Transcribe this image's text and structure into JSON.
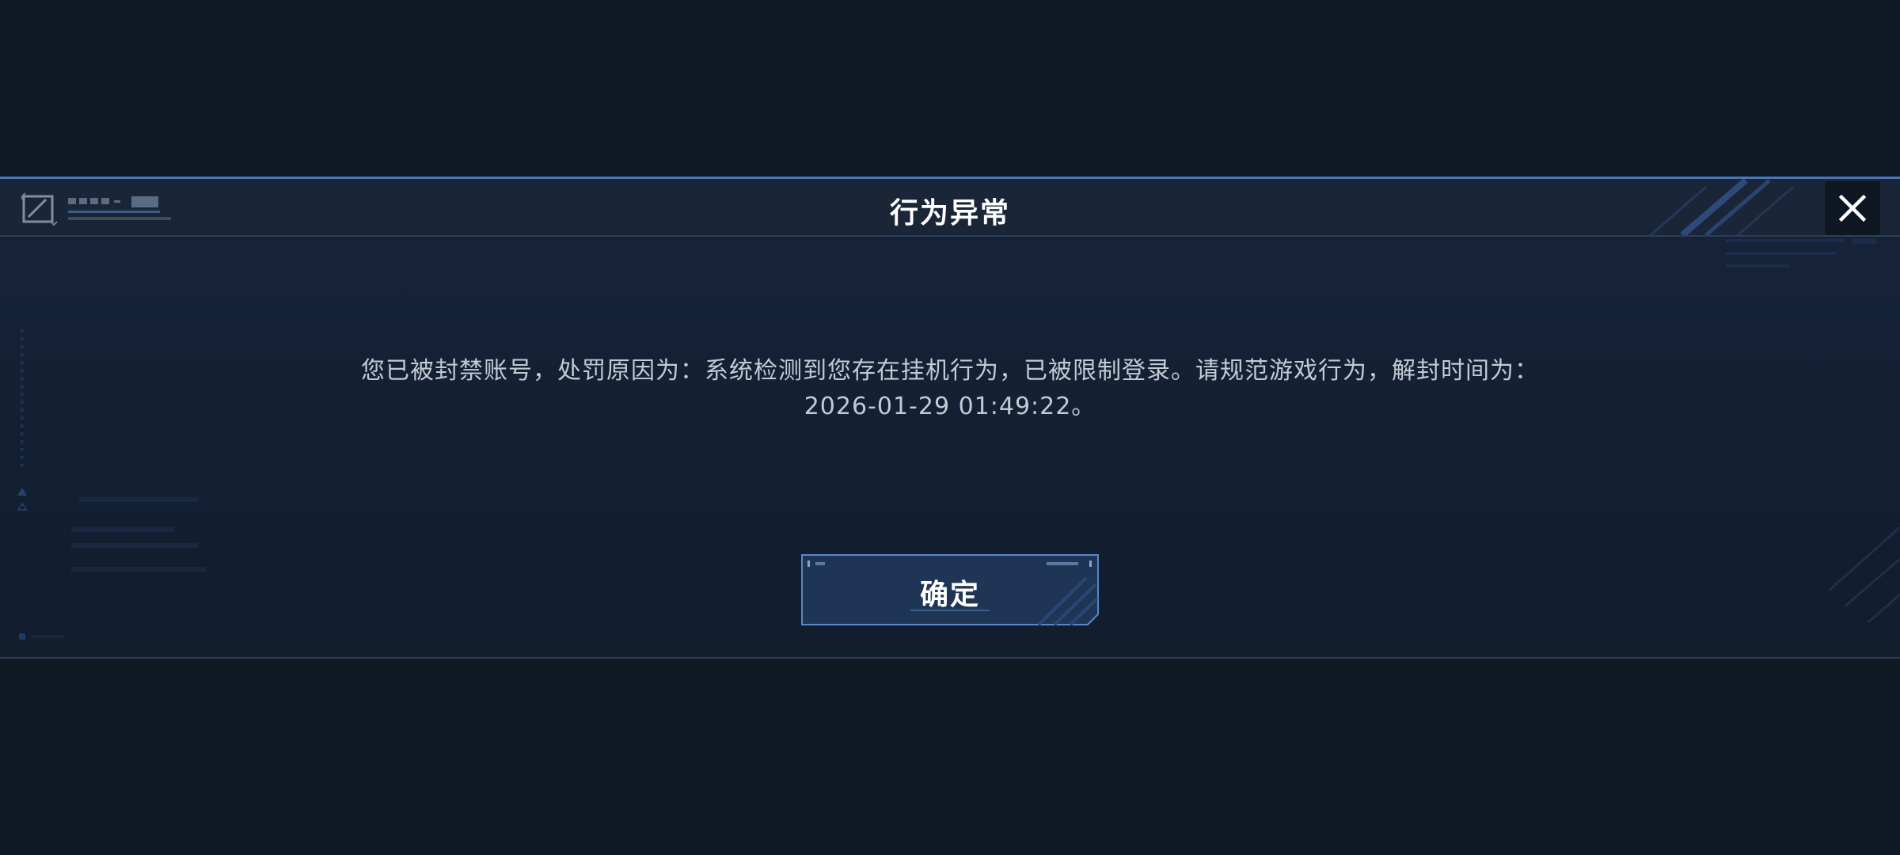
{
  "dialog": {
    "title": "行为异常",
    "message": "您已被封禁账号，处罚原因为：系统检测到您存在挂机行为，已被限制登录。请规范游戏行为，解封时间为：2026-01-29 01:49:22。",
    "confirm_label": "确定"
  },
  "icons": {
    "close": "close-icon",
    "logo": "nz-logo"
  },
  "colors": {
    "background": "#111a24",
    "dialog_border": "#4a73b8",
    "button_fill": "#1f3556",
    "button_border": "#5a86c8",
    "title_text": "#ffffff",
    "message_text": "#c3cad4"
  }
}
